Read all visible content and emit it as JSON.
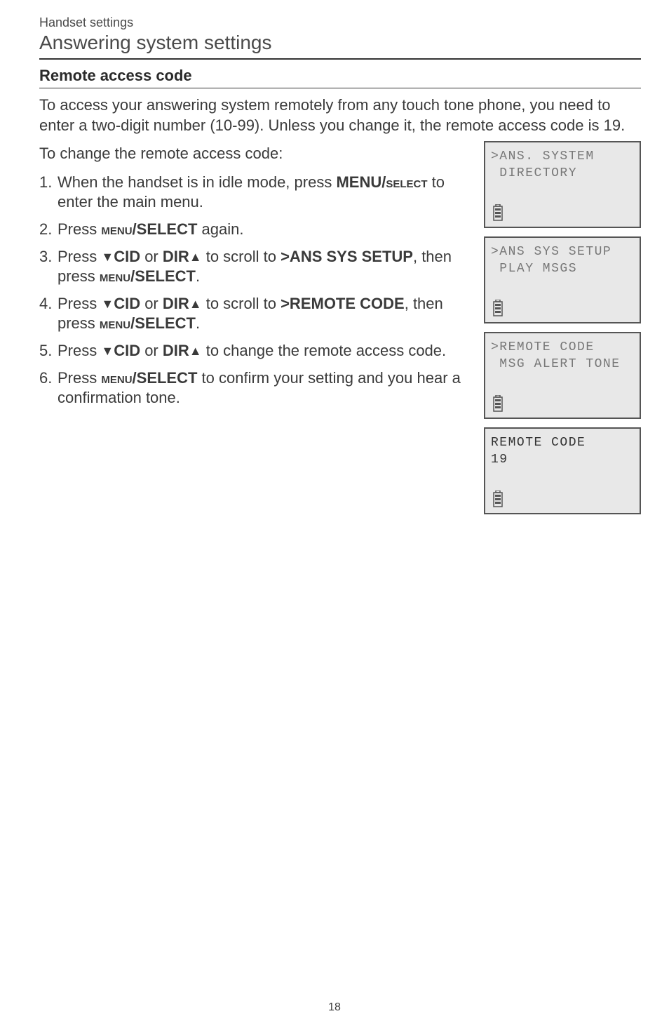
{
  "header": {
    "small": "Handset settings",
    "large": "Answering system settings"
  },
  "section_title": "Remote access code",
  "intro": "To access your answering system remotely from any touch tone phone, you need to enter a two-digit number (10-99). Unless you change it, the remote access code is 19.",
  "lead": "To change the remote access code:",
  "steps": [
    {
      "num": "1.",
      "prefix": "When the handset is in idle mode, press ",
      "bold1": "MENU/",
      "sc1": "select",
      "suffix1": " to enter the main menu."
    },
    {
      "num": "2.",
      "prefix": "Press ",
      "sc1": "menu",
      "bold1": "/SELECT",
      "suffix1": " again."
    },
    {
      "num": "3.",
      "prefix": "Press ",
      "tri1": "▼",
      "bold_cid1": "CID",
      "or1": " or ",
      "bold_dir1": "DIR",
      "tri2": "▲",
      "mid1": " to scroll to ",
      "bold_target": ">ANS SYS SETUP",
      "mid2": ", then press ",
      "sc1": "menu",
      "bold1": "/SELECT",
      "suffix1": "."
    },
    {
      "num": "4.",
      "prefix": "Press ",
      "tri1": "▼",
      "bold_cid1": "CID",
      "or1": " or ",
      "bold_dir1": "DIR",
      "tri2": "▲",
      "mid1": " to scroll to ",
      "bold_target": ">REMOTE CODE",
      "mid2": ", then press ",
      "sc1": "menu",
      "bold1": "/SELECT",
      "suffix1": "."
    },
    {
      "num": "5.",
      "prefix": "Press ",
      "tri1": "▼",
      "bold_cid1": "CID",
      "or1": " or ",
      "bold_dir1": "DIR",
      "tri2": "▲",
      "mid1": " to change the remote access code."
    },
    {
      "num": "6.",
      "prefix": "Press ",
      "sc1": "menu",
      "bold1": "/SELECT",
      "suffix1": " to confirm your setting and you hear a confirmation tone."
    }
  ],
  "screens": [
    {
      "lines": [
        {
          "text": ">ANS. SYSTEM",
          "dark": false
        },
        {
          "text": " DIRECTORY",
          "dark": false
        }
      ]
    },
    {
      "lines": [
        {
          "text": ">ANS SYS SETUP",
          "dark": false
        },
        {
          "text": " PLAY MSGS",
          "dark": false
        }
      ]
    },
    {
      "lines": [
        {
          "text": ">REMOTE CODE",
          "dark": false
        },
        {
          "text": " MSG ALERT TONE",
          "dark": false
        }
      ]
    },
    {
      "lines": [
        {
          "text": "REMOTE CODE",
          "dark": true
        },
        {
          "text": "19",
          "dark": true
        }
      ]
    }
  ],
  "page_number": "18"
}
